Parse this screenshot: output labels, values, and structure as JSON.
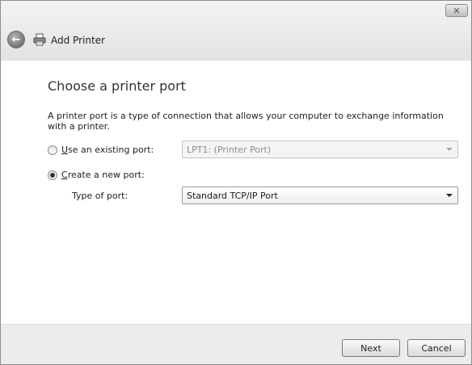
{
  "window": {
    "title": "Add Printer",
    "close_label": "✕"
  },
  "page": {
    "heading": "Choose a printer port",
    "description": "A printer port is a type of connection that allows your computer to exchange information with a printer."
  },
  "options": {
    "existing_port": {
      "label_underline": "U",
      "label_rest": "se an existing port:",
      "selected": false,
      "value": "LPT1: (Printer Port)"
    },
    "new_port": {
      "label_underline": "C",
      "label_rest": "reate a new port:",
      "selected": true
    },
    "port_type": {
      "label": "Type of port:",
      "value": "Standard TCP/IP Port"
    }
  },
  "buttons": {
    "next": "Next",
    "cancel": "Cancel"
  }
}
